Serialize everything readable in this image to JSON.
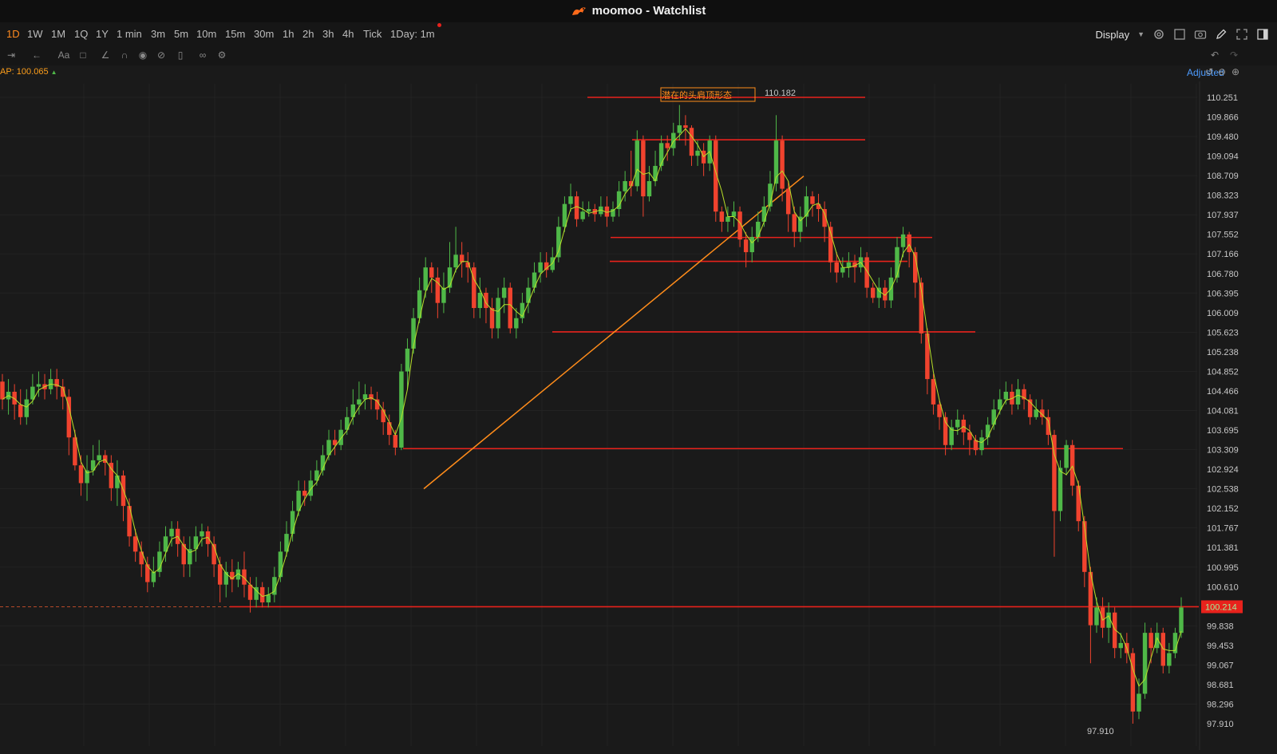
{
  "window": {
    "title": "moomoo - Watchlist"
  },
  "periods": [
    "1D",
    "1W",
    "1M",
    "1Q",
    "1Y",
    "1 min",
    "3m",
    "5m",
    "10m",
    "15m",
    "30m",
    "1h",
    "2h",
    "3h",
    "4h",
    "Tick",
    "1Day: 1m"
  ],
  "active_period": "1D",
  "toolbar": {
    "display_label": "Display"
  },
  "indicator": {
    "vwap_label": "AP:",
    "vwap_value": "100.065"
  },
  "adjusted_label": "Adjusted",
  "price_axis": [
    "110.251",
    "109.866",
    "109.480",
    "109.094",
    "108.709",
    "108.323",
    "107.937",
    "107.552",
    "107.166",
    "106.780",
    "106.395",
    "106.009",
    "105.623",
    "105.238",
    "104.852",
    "104.466",
    "104.081",
    "103.695",
    "103.309",
    "102.924",
    "102.538",
    "102.152",
    "101.767",
    "101.381",
    "100.995",
    "100.610",
    "99.838",
    "99.453",
    "99.067",
    "98.681",
    "98.296",
    "97.910"
  ],
  "current_price": "100.214",
  "annotations": {
    "pattern_label": "潜在的头肩顶形态",
    "high_label": "110.182",
    "low_label": "97.910"
  },
  "colors": {
    "bull": "#4fb848",
    "bear": "#f0432e",
    "ma": "#b8e02a",
    "line": "#e8221c",
    "trend": "#ff8c1a",
    "accent": "#ff8a1f",
    "price_tag": "#e8221c"
  },
  "chart_data": {
    "type": "candlestick",
    "y_axis_range": [
      97.91,
      110.25
    ],
    "horizontal_levels": [
      110.251,
      109.415,
      107.49,
      107.02,
      105.63,
      103.33,
      100.214
    ],
    "trend_line": {
      "from": 102.538,
      "to": 108.7
    },
    "candles": [
      [
        104.65,
        104.3,
        104.8,
        104.1
      ],
      [
        104.3,
        104.45,
        104.7,
        104.0
      ],
      [
        104.45,
        104.2,
        104.6,
        103.9
      ],
      [
        104.2,
        103.95,
        104.5,
        103.8
      ],
      [
        103.95,
        104.3,
        104.5,
        103.8
      ],
      [
        104.3,
        104.55,
        104.8,
        104.2
      ],
      [
        104.55,
        104.6,
        104.85,
        104.35
      ],
      [
        104.6,
        104.5,
        104.8,
        104.3
      ],
      [
        104.5,
        104.7,
        104.9,
        104.4
      ],
      [
        104.7,
        104.55,
        104.9,
        104.3
      ],
      [
        104.55,
        104.35,
        104.7,
        104.1
      ],
      [
        104.35,
        103.55,
        104.5,
        103.2
      ],
      [
        103.55,
        103.0,
        103.7,
        102.9
      ],
      [
        103.0,
        102.65,
        103.2,
        102.4
      ],
      [
        102.65,
        102.9,
        103.2,
        102.3
      ],
      [
        102.9,
        103.1,
        103.4,
        102.8
      ],
      [
        103.1,
        103.2,
        103.5,
        103.0
      ],
      [
        103.2,
        103.05,
        103.3,
        102.8
      ],
      [
        103.05,
        102.55,
        103.2,
        102.3
      ],
      [
        102.55,
        102.8,
        103.1,
        102.2
      ],
      [
        102.8,
        102.2,
        102.9,
        101.9
      ],
      [
        102.2,
        101.6,
        102.35,
        101.4
      ],
      [
        101.6,
        101.3,
        101.75,
        101.1
      ],
      [
        101.3,
        101.05,
        101.5,
        100.8
      ],
      [
        101.05,
        100.7,
        101.2,
        100.5
      ],
      [
        100.7,
        100.9,
        101.2,
        100.6
      ],
      [
        100.9,
        101.3,
        101.5,
        100.8
      ],
      [
        101.3,
        101.6,
        101.8,
        101.1
      ],
      [
        101.6,
        101.75,
        101.9,
        101.4
      ],
      [
        101.75,
        101.45,
        101.9,
        101.2
      ],
      [
        101.45,
        101.05,
        101.6,
        100.8
      ],
      [
        101.05,
        101.35,
        101.6,
        100.8
      ],
      [
        101.35,
        101.6,
        101.8,
        101.1
      ],
      [
        101.6,
        101.7,
        101.85,
        101.4
      ],
      [
        101.7,
        101.45,
        101.8,
        101.2
      ],
      [
        101.45,
        101.05,
        101.6,
        100.8
      ],
      [
        101.05,
        100.65,
        101.2,
        100.3
      ],
      [
        100.65,
        100.9,
        101.1,
        100.4
      ],
      [
        100.9,
        100.75,
        101.15,
        100.5
      ],
      [
        100.75,
        100.95,
        101.1,
        100.6
      ],
      [
        100.95,
        100.65,
        101.3,
        100.4
      ],
      [
        100.65,
        100.35,
        100.8,
        100.1
      ],
      [
        100.35,
        100.6,
        100.8,
        100.2
      ],
      [
        100.6,
        100.3,
        100.7,
        100.2
      ],
      [
        100.3,
        100.45,
        100.6,
        100.2
      ],
      [
        100.45,
        100.8,
        101.0,
        100.3
      ],
      [
        100.8,
        101.3,
        101.5,
        100.7
      ],
      [
        101.3,
        101.65,
        101.9,
        101.2
      ],
      [
        101.65,
        102.1,
        102.3,
        101.5
      ],
      [
        102.1,
        102.5,
        102.7,
        102.0
      ],
      [
        102.5,
        102.4,
        102.7,
        102.2
      ],
      [
        102.4,
        102.7,
        102.9,
        102.3
      ],
      [
        102.7,
        102.9,
        103.1,
        102.6
      ],
      [
        102.9,
        103.2,
        103.4,
        102.8
      ],
      [
        103.2,
        103.5,
        103.7,
        103.1
      ],
      [
        103.5,
        103.4,
        103.7,
        103.2
      ],
      [
        103.4,
        103.7,
        103.9,
        103.3
      ],
      [
        103.7,
        103.95,
        104.15,
        103.6
      ],
      [
        103.95,
        104.2,
        104.5,
        103.8
      ],
      [
        104.2,
        104.3,
        104.65,
        104.0
      ],
      [
        104.3,
        104.4,
        104.6,
        104.1
      ],
      [
        104.4,
        104.3,
        104.55,
        104.1
      ],
      [
        104.3,
        104.1,
        104.45,
        103.9
      ],
      [
        104.1,
        103.85,
        104.25,
        103.6
      ],
      [
        103.85,
        103.6,
        104.0,
        103.4
      ],
      [
        103.6,
        103.35,
        103.7,
        103.2
      ],
      [
        103.35,
        104.85,
        105.0,
        103.3
      ],
      [
        104.85,
        105.3,
        105.5,
        104.5
      ],
      [
        105.3,
        105.9,
        106.1,
        105.2
      ],
      [
        105.9,
        106.45,
        106.7,
        105.8
      ],
      [
        106.45,
        106.9,
        107.1,
        106.3
      ],
      [
        106.9,
        106.7,
        107.0,
        106.4
      ],
      [
        106.7,
        106.2,
        106.9,
        105.9
      ],
      [
        106.2,
        106.5,
        106.8,
        106.0
      ],
      [
        106.5,
        106.9,
        107.4,
        106.4
      ],
      [
        106.9,
        107.15,
        107.7,
        106.8
      ],
      [
        107.15,
        107.0,
        107.4,
        106.7
      ],
      [
        107.0,
        106.9,
        107.2,
        106.6
      ],
      [
        106.9,
        106.1,
        107.0,
        105.9
      ],
      [
        106.1,
        106.4,
        106.7,
        105.9
      ],
      [
        106.4,
        106.1,
        106.5,
        105.8
      ],
      [
        106.1,
        105.7,
        106.3,
        105.5
      ],
      [
        105.7,
        106.3,
        106.5,
        105.5
      ],
      [
        106.3,
        106.5,
        106.7,
        106.0
      ],
      [
        106.5,
        105.7,
        106.6,
        105.6
      ],
      [
        105.7,
        105.9,
        106.1,
        105.5
      ],
      [
        105.9,
        106.2,
        106.4,
        105.8
      ],
      [
        106.2,
        106.5,
        106.7,
        106.0
      ],
      [
        106.5,
        106.8,
        107.0,
        106.4
      ],
      [
        106.8,
        107.0,
        107.2,
        106.6
      ],
      [
        107.0,
        106.85,
        107.2,
        106.7
      ],
      [
        106.85,
        107.1,
        107.3,
        106.8
      ],
      [
        107.1,
        107.7,
        107.9,
        107.0
      ],
      [
        107.7,
        108.15,
        108.3,
        107.6
      ],
      [
        108.15,
        108.3,
        108.55,
        108.0
      ],
      [
        108.3,
        107.85,
        108.4,
        107.7
      ],
      [
        107.85,
        108.0,
        108.2,
        107.8
      ],
      [
        108.0,
        108.05,
        108.2,
        107.9
      ],
      [
        108.05,
        107.95,
        108.15,
        107.8
      ],
      [
        107.95,
        108.1,
        108.3,
        107.9
      ],
      [
        108.1,
        107.9,
        108.3,
        107.7
      ],
      [
        107.9,
        108.05,
        108.2,
        107.8
      ],
      [
        108.05,
        108.4,
        108.6,
        107.9
      ],
      [
        108.4,
        108.6,
        108.8,
        108.2
      ],
      [
        108.6,
        108.5,
        109.2,
        108.3
      ],
      [
        108.5,
        109.4,
        109.6,
        108.4
      ],
      [
        109.4,
        108.3,
        109.5,
        107.9
      ],
      [
        108.3,
        108.6,
        108.9,
        108.2
      ],
      [
        108.6,
        108.9,
        109.2,
        108.5
      ],
      [
        108.9,
        109.35,
        109.5,
        108.8
      ],
      [
        109.35,
        109.25,
        109.5,
        109.0
      ],
      [
        109.25,
        109.55,
        109.75,
        109.1
      ],
      [
        109.55,
        109.7,
        110.1,
        109.4
      ],
      [
        109.7,
        109.65,
        109.9,
        109.3
      ],
      [
        109.65,
        109.1,
        109.7,
        108.9
      ],
      [
        109.1,
        109.2,
        109.4,
        108.9
      ],
      [
        109.2,
        108.95,
        109.35,
        108.7
      ],
      [
        108.95,
        109.4,
        109.5,
        108.8
      ],
      [
        109.4,
        108.0,
        109.5,
        107.8
      ],
      [
        108.0,
        107.8,
        108.1,
        107.6
      ],
      [
        107.8,
        107.9,
        108.1,
        107.6
      ],
      [
        107.9,
        108.0,
        108.2,
        107.7
      ],
      [
        108.0,
        107.45,
        108.1,
        107.3
      ],
      [
        107.45,
        107.2,
        107.6,
        106.9
      ],
      [
        107.2,
        107.5,
        107.7,
        107.0
      ],
      [
        107.5,
        107.8,
        108.0,
        107.4
      ],
      [
        107.8,
        108.1,
        108.3,
        107.7
      ],
      [
        108.1,
        108.55,
        108.8,
        108.0
      ],
      [
        108.55,
        109.4,
        109.9,
        108.4
      ],
      [
        109.4,
        108.45,
        109.5,
        108.2
      ],
      [
        108.45,
        107.95,
        108.6,
        107.6
      ],
      [
        107.95,
        107.6,
        108.1,
        107.3
      ],
      [
        107.6,
        107.9,
        108.1,
        107.4
      ],
      [
        107.9,
        108.3,
        108.5,
        107.7
      ],
      [
        108.3,
        108.15,
        108.4,
        107.9
      ],
      [
        108.15,
        108.05,
        108.35,
        107.8
      ],
      [
        108.05,
        107.7,
        108.2,
        107.4
      ],
      [
        107.7,
        107.0,
        107.8,
        106.8
      ],
      [
        107.0,
        106.8,
        107.2,
        106.6
      ],
      [
        106.8,
        106.9,
        107.1,
        106.7
      ],
      [
        106.9,
        107.0,
        107.2,
        106.7
      ],
      [
        107.0,
        106.9,
        107.15,
        106.6
      ],
      [
        106.9,
        107.1,
        107.3,
        106.8
      ],
      [
        107.1,
        106.5,
        107.2,
        106.3
      ],
      [
        106.5,
        106.3,
        106.6,
        106.2
      ],
      [
        106.3,
        106.5,
        106.7,
        106.1
      ],
      [
        106.5,
        106.25,
        106.65,
        106.1
      ],
      [
        106.25,
        106.7,
        106.9,
        106.1
      ],
      [
        106.7,
        107.3,
        107.5,
        106.6
      ],
      [
        107.3,
        107.55,
        107.7,
        107.1
      ],
      [
        107.55,
        107.2,
        107.6,
        106.9
      ],
      [
        107.2,
        106.6,
        107.3,
        106.3
      ],
      [
        106.6,
        105.6,
        106.7,
        105.4
      ],
      [
        105.6,
        104.7,
        105.7,
        104.4
      ],
      [
        104.7,
        104.2,
        104.8,
        104.0
      ],
      [
        104.2,
        103.95,
        104.3,
        103.7
      ],
      [
        103.95,
        103.4,
        104.05,
        103.2
      ],
      [
        103.4,
        103.75,
        103.9,
        103.3
      ],
      [
        103.75,
        103.9,
        104.1,
        103.6
      ],
      [
        103.9,
        103.65,
        104.0,
        103.4
      ],
      [
        103.65,
        103.5,
        103.8,
        103.2
      ],
      [
        103.5,
        103.3,
        103.6,
        103.2
      ],
      [
        103.3,
        103.55,
        103.7,
        103.2
      ],
      [
        103.55,
        103.8,
        103.95,
        103.4
      ],
      [
        103.8,
        104.1,
        104.3,
        103.7
      ],
      [
        104.1,
        104.3,
        104.5,
        104.0
      ],
      [
        104.3,
        104.45,
        104.65,
        104.2
      ],
      [
        104.45,
        104.2,
        104.6,
        104.0
      ],
      [
        104.2,
        104.5,
        104.7,
        104.1
      ],
      [
        104.5,
        104.3,
        104.6,
        104.1
      ],
      [
        104.3,
        103.95,
        104.4,
        103.8
      ],
      [
        103.95,
        104.1,
        104.3,
        103.9
      ],
      [
        104.1,
        103.95,
        104.3,
        103.8
      ],
      [
        103.95,
        103.6,
        104.1,
        103.4
      ],
      [
        103.6,
        102.1,
        103.7,
        101.2
      ],
      [
        102.1,
        102.95,
        103.1,
        101.9
      ],
      [
        102.95,
        103.4,
        103.5,
        102.8
      ],
      [
        103.4,
        102.6,
        103.5,
        102.4
      ],
      [
        102.6,
        101.9,
        102.7,
        101.7
      ],
      [
        101.9,
        100.9,
        102.0,
        100.6
      ],
      [
        100.9,
        99.85,
        101.0,
        99.1
      ],
      [
        99.85,
        100.2,
        100.4,
        99.7
      ],
      [
        100.2,
        99.8,
        100.4,
        99.6
      ],
      [
        99.8,
        100.1,
        100.3,
        99.5
      ],
      [
        100.1,
        99.4,
        100.2,
        99.2
      ],
      [
        99.4,
        99.5,
        99.7,
        99.2
      ],
      [
        99.5,
        99.3,
        99.7,
        99.1
      ],
      [
        99.3,
        98.15,
        99.4,
        97.91
      ],
      [
        98.15,
        98.5,
        98.8,
        98.0
      ],
      [
        98.5,
        99.7,
        99.9,
        98.4
      ],
      [
        99.7,
        99.4,
        99.8,
        99.1
      ],
      [
        99.4,
        99.7,
        99.9,
        99.3
      ],
      [
        99.7,
        99.05,
        99.8,
        98.9
      ],
      [
        99.05,
        99.3,
        99.5,
        98.9
      ],
      [
        99.3,
        99.7,
        99.8,
        99.2
      ],
      [
        99.7,
        100.2,
        100.4,
        99.6
      ]
    ]
  }
}
